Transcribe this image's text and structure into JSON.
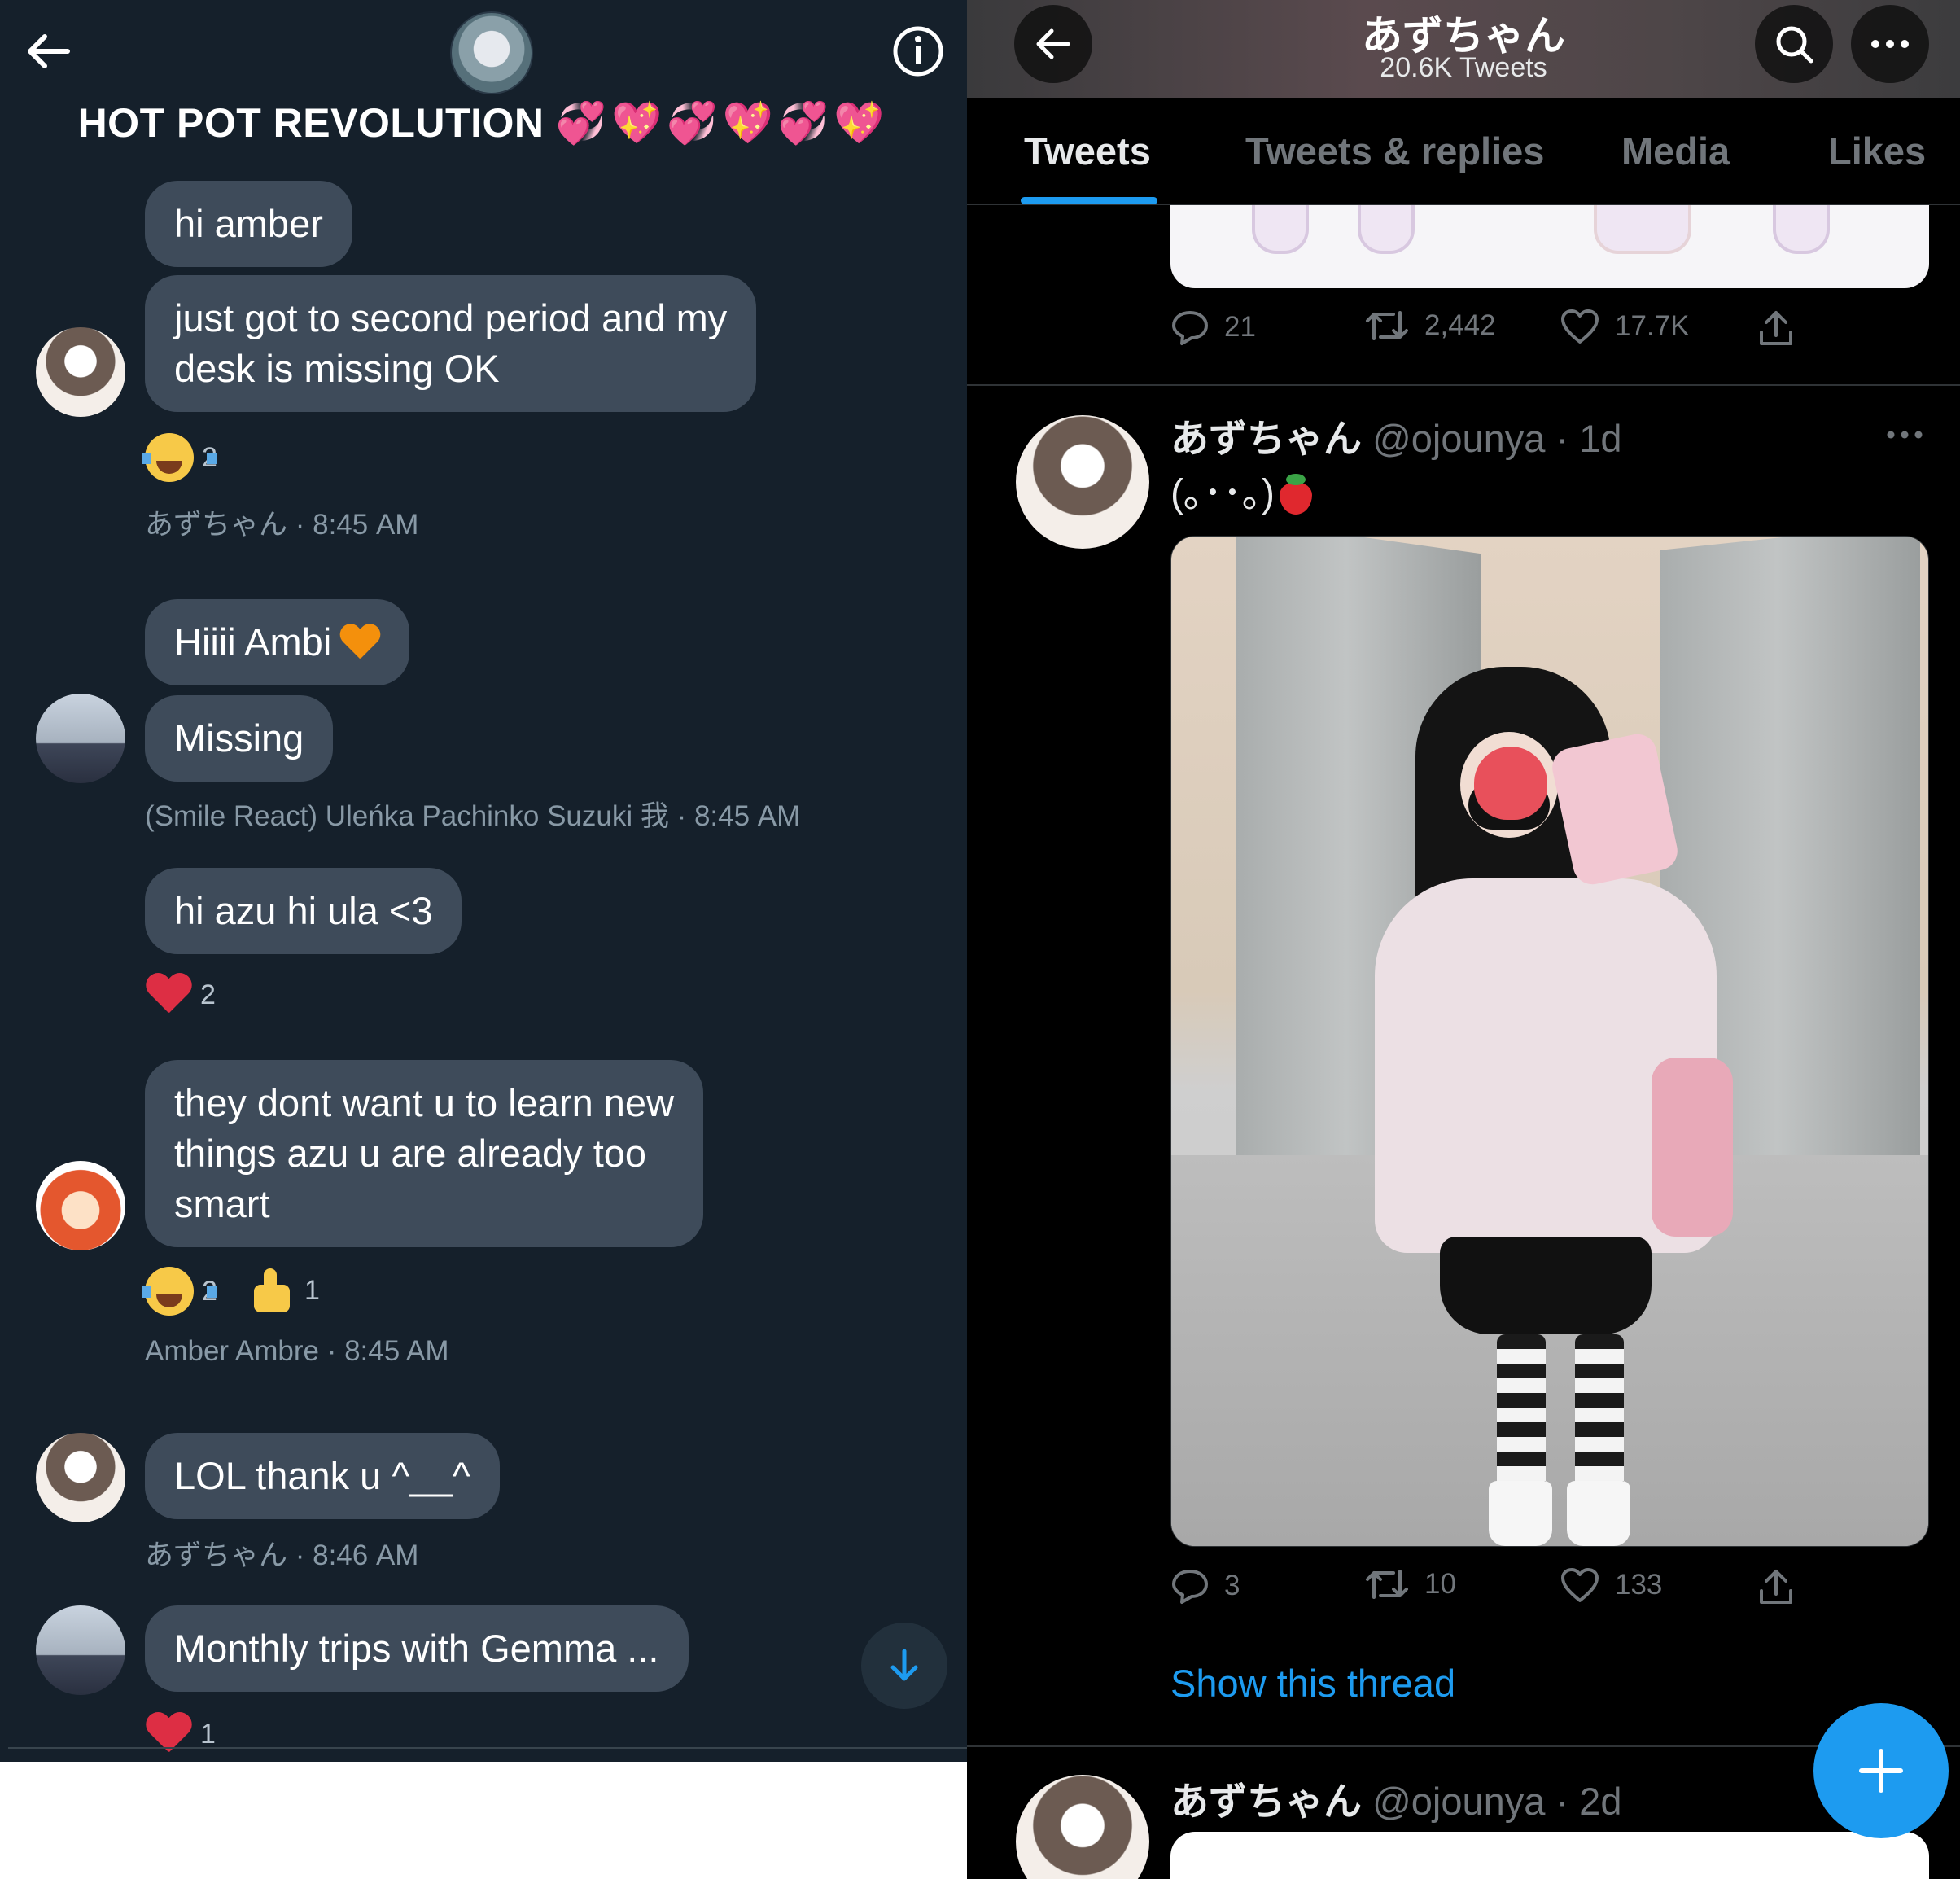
{
  "dm": {
    "title": "HOT POT REVOLUTION",
    "title_emoji": "💞💖💞💖💞💖",
    "messages": [
      {
        "text": "hi amber"
      },
      {
        "text_lines": [
          "just got to second period and my",
          "desk is missing OK"
        ],
        "reaction_count": "2",
        "meta": "あずちゃん · 8:45 AM"
      },
      {
        "text": "Hiiii Ambi"
      },
      {
        "text": "Missing",
        "meta": "(Smile React) Uleńka Pachinko Suzuki 我 · 8:45 AM"
      },
      {
        "text": "hi azu hi ula <3",
        "reaction_count": "2"
      },
      {
        "text_lines": [
          "they dont want u to learn new",
          "things azu u are already too",
          "smart"
        ],
        "reaction_count": "2",
        "reaction2_count": "1",
        "meta": "Amber Ambre · 8:45 AM"
      },
      {
        "text": "LOL thank u ^__^",
        "meta": "あずちゃん · 8:46 AM"
      },
      {
        "text": "Monthly trips with Gemma ...",
        "reaction_count": "1"
      }
    ],
    "icons": {
      "back": "back-arrow-icon",
      "info": "info-icon",
      "scroll": "arrow-down-icon"
    }
  },
  "profile": {
    "name": "あずちゃん",
    "tweet_count": "20.6K Tweets",
    "tabs": [
      "Tweets",
      "Tweets & replies",
      "Media",
      "Likes"
    ],
    "prev_tweet_actions": {
      "replies": "21",
      "retweets": "2,442",
      "likes": "17.7K"
    },
    "tweet": {
      "name": "あずちゃん",
      "handle": "@ojounya · 1d",
      "text": "(｡･･｡)",
      "actions": {
        "replies": "3",
        "retweets": "10",
        "likes": "133"
      },
      "show_thread": "Show this thread"
    },
    "next_tweet": {
      "name": "あずちゃん",
      "handle": "@ojounya · 2d"
    },
    "accent_color": "#1d9bf0"
  }
}
